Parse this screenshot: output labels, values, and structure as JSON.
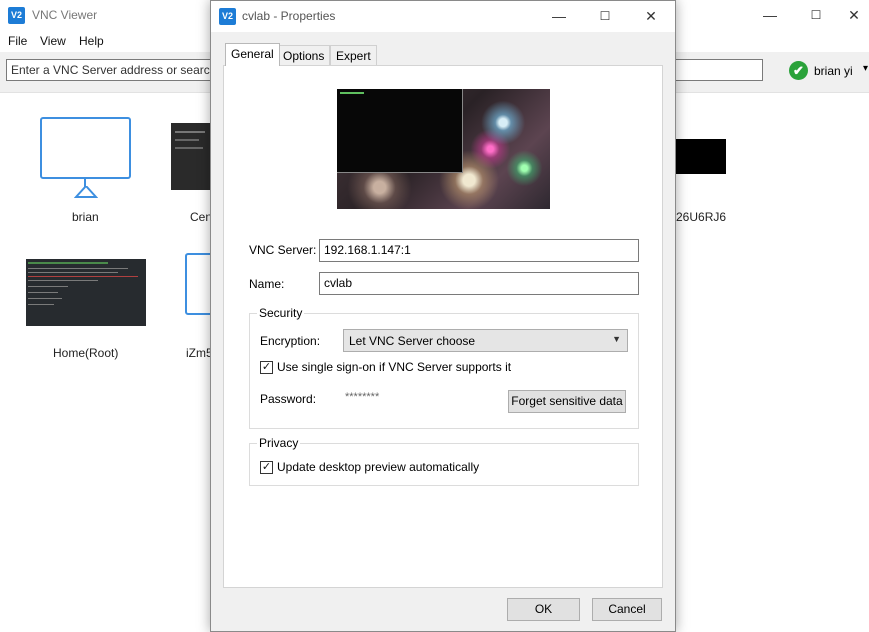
{
  "main_window": {
    "app_logo": "V2",
    "title": "VNC Viewer",
    "controls": {
      "minimize": "—",
      "maximize": "☐",
      "close": "✕"
    },
    "menu": [
      "File",
      "View",
      "Help"
    ],
    "search": {
      "placeholder": "Enter a VNC Server address or search"
    },
    "user": {
      "name": "brian yi",
      "status_icon": "✔",
      "caret": "▾"
    },
    "tiles": [
      {
        "label": "brian",
        "type": "monitor"
      },
      {
        "label": "Cen",
        "type": "screenshot"
      },
      {
        "label": "26U6RJ6",
        "type": "screenshot"
      },
      {
        "label": "Home(Root)",
        "type": "screenshot"
      },
      {
        "label": "iZm5",
        "type": "monitor"
      }
    ]
  },
  "dialog": {
    "app_logo": "V2",
    "title": "cvlab - Properties",
    "controls": {
      "minimize": "—",
      "maximize": "☐",
      "close": "✕"
    },
    "tabs": [
      "General",
      "Options",
      "Expert"
    ],
    "active_tab": "General",
    "vnc_server": {
      "label": "VNC Server:",
      "value": "192.168.1.147:1"
    },
    "name": {
      "label": "Name:",
      "value": "cvlab"
    },
    "security": {
      "title": "Security",
      "encryption_label": "Encryption:",
      "encryption_value": "Let VNC Server choose",
      "sso_label": "Use single sign-on if VNC Server supports it",
      "sso_checked": true,
      "password_label": "Password:",
      "password_mask": "********",
      "forget_button": "Forget sensitive data"
    },
    "privacy": {
      "title": "Privacy",
      "preview_label": "Update desktop preview automatically",
      "preview_checked": true
    },
    "buttons": {
      "ok": "OK",
      "cancel": "Cancel"
    }
  }
}
